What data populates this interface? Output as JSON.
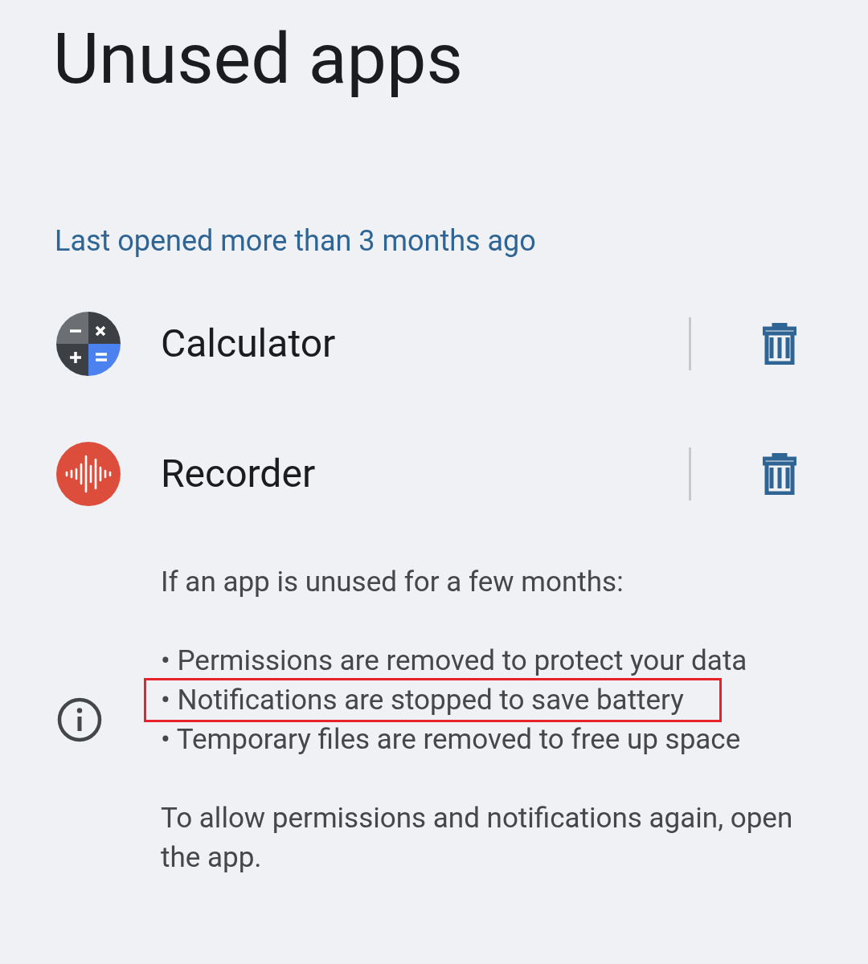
{
  "title": "Unused apps",
  "section_header": "Last opened more than 3 months ago",
  "apps": [
    {
      "name": "Calculator",
      "kind": "calculator"
    },
    {
      "name": "Recorder",
      "kind": "recorder"
    }
  ],
  "info": {
    "intro": "If an app is unused for a few months:",
    "bullets": [
      {
        "text": "• Permissions are removed to protect your data",
        "highlighted": false
      },
      {
        "text": "• Notifications are stopped to save battery",
        "highlighted": true
      },
      {
        "text": "• Temporary files are removed to free up space",
        "highlighted": false
      }
    ],
    "footer": "To allow permissions and notifications again, open the app."
  }
}
